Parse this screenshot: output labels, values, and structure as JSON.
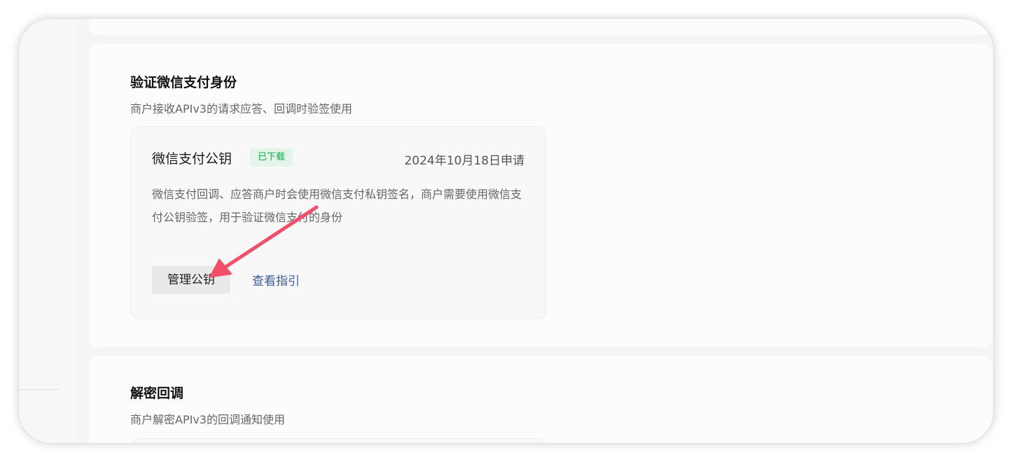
{
  "section_verify": {
    "title": "验证微信支付身份",
    "subtitle": "商户接收APIv3的请求应答、回调时验签使用"
  },
  "public_key_card": {
    "title": "微信支付公钥",
    "badge": "已下载",
    "date": "2024年10月18日申请",
    "description": "微信支付回调、应答商户时会使用微信支付私钥签名，商户需要使用微信支付公钥验签，用于验证微信支付的身份",
    "manage_button": "管理公钥",
    "guide_link": "查看指引"
  },
  "section_decrypt": {
    "title": "解密回调",
    "subtitle": "商户解密APIv3的回调通知使用"
  },
  "colors": {
    "badge_text": "#11a84a",
    "badge_bg": "#e3f5e9",
    "link": "#3a5b95",
    "annotation_arrow": "#f2506a"
  },
  "icons": {
    "annotation": "red-arrow-icon"
  }
}
